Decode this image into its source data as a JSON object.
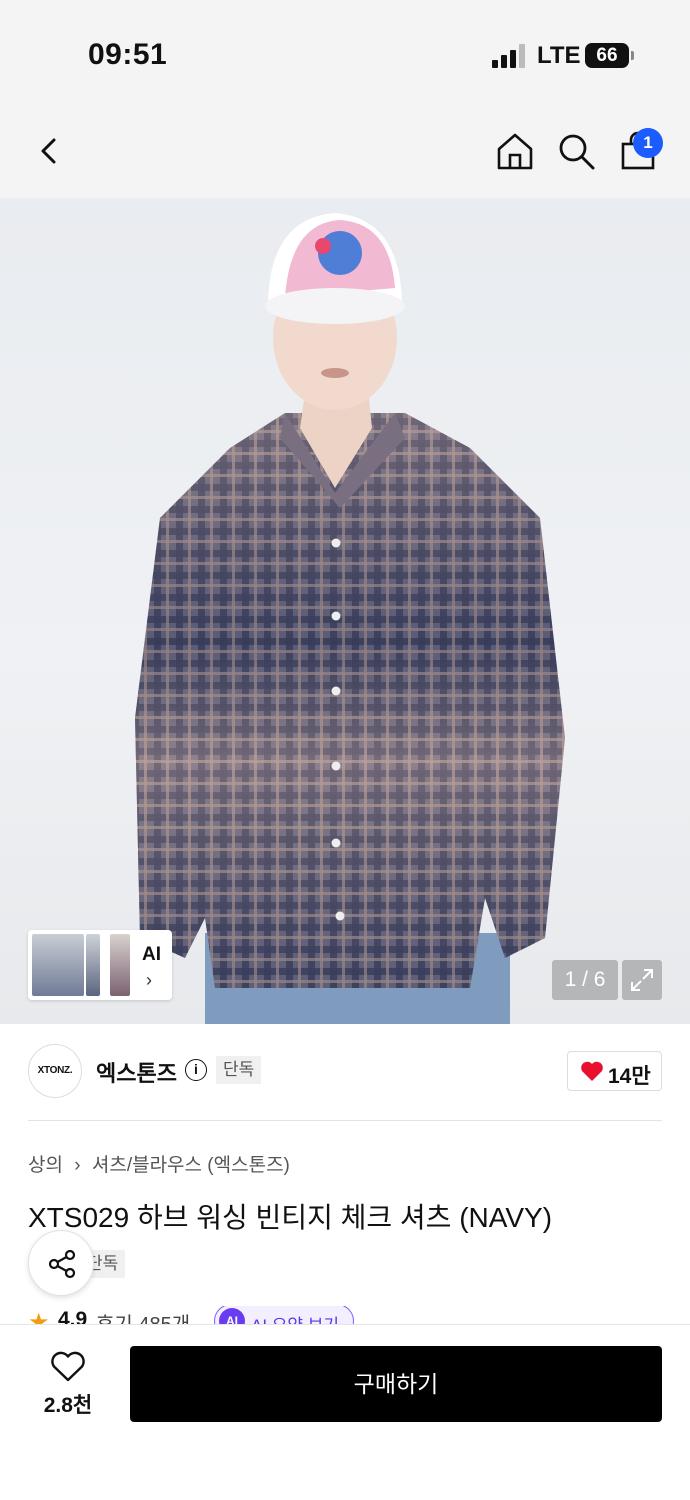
{
  "status_bar": {
    "time": "09:51",
    "network": "LTE",
    "battery": "66"
  },
  "nav": {
    "cart_count": "1"
  },
  "gallery": {
    "thumb_strip_label": "AI",
    "counter": "1 / 6"
  },
  "brand": {
    "logo_text": "XTONZ.",
    "name": "엑스톤즈",
    "badge": "단독",
    "likes": "14만"
  },
  "breadcrumb": [
    "상의",
    "셔츠/블라우스 (엑스톤즈)"
  ],
  "product": {
    "title": "XTS029 하브 워싱 빈티지 체크 셔츠 (NAVY)",
    "tag": "단독",
    "rating": "4.9",
    "reviews": "후기 485개",
    "ai_summary_label": "AI 요약 보기",
    "ai_dot": "AI"
  },
  "bottom_bar": {
    "wishlist_count": "2.8천",
    "buy_label": "구매하기"
  }
}
